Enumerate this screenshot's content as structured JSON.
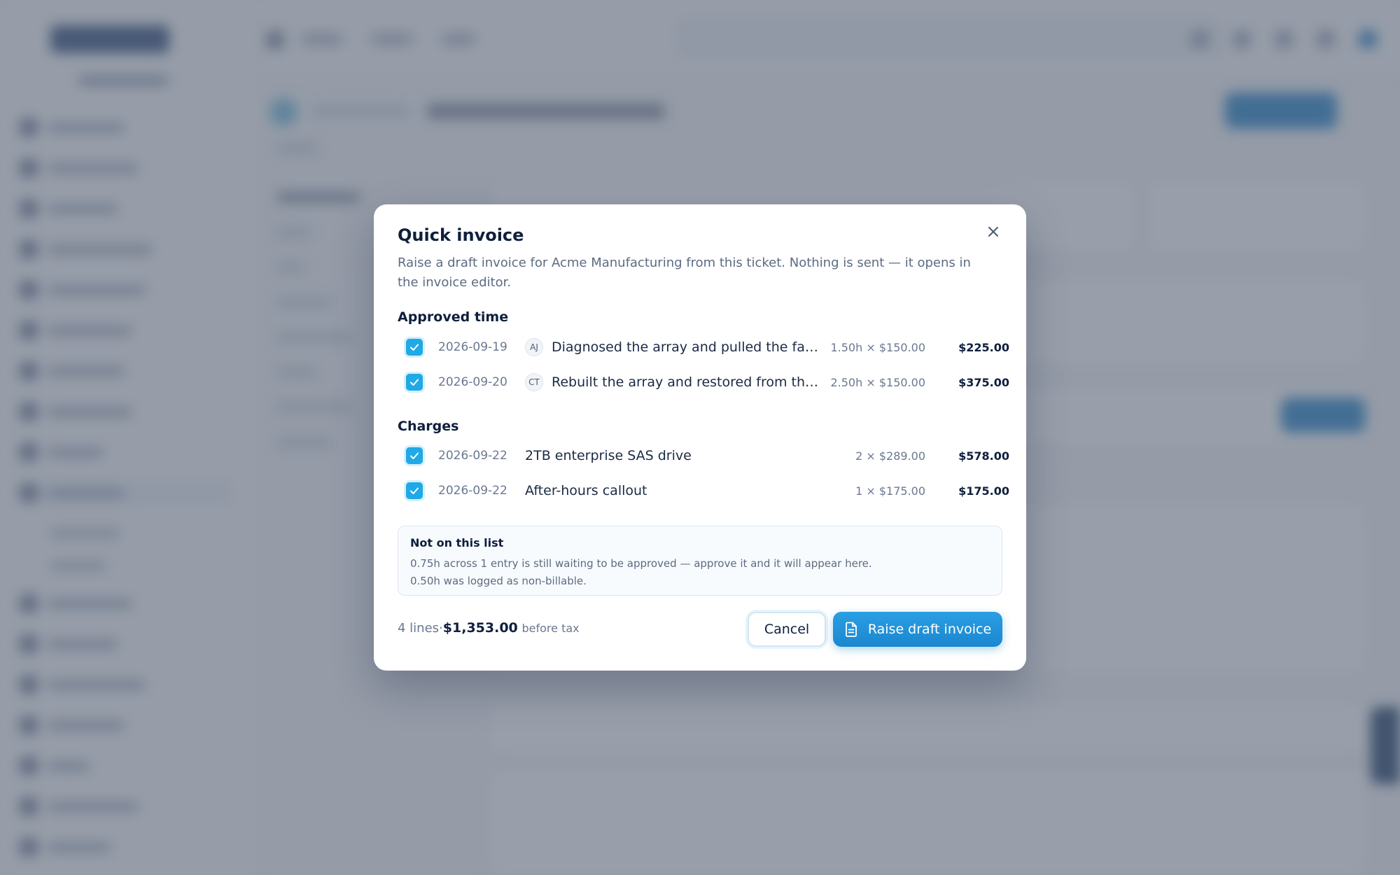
{
  "modal": {
    "title": "Quick invoice",
    "description": "Raise a draft invoice for Acme Manufacturing from this ticket. Nothing is sent — it opens in the invoice editor.",
    "close_icon": "close-icon",
    "approved_time": {
      "heading": "Approved time",
      "rows": [
        {
          "checked": true,
          "date": "2026-09-19",
          "initials": "AJ",
          "description": "Diagnosed the array and pulled the failed ...",
          "qty": "1.50h × $150.00",
          "amount": "$225.00"
        },
        {
          "checked": true,
          "date": "2026-09-20",
          "initials": "CT",
          "description": "Rebuilt the array and restored from the ov...",
          "qty": "2.50h × $150.00",
          "amount": "$375.00"
        }
      ]
    },
    "charges": {
      "heading": "Charges",
      "rows": [
        {
          "checked": true,
          "date": "2026-09-22",
          "description": "2TB enterprise SAS drive",
          "qty": "2 × $289.00",
          "amount": "$578.00"
        },
        {
          "checked": true,
          "date": "2026-09-22",
          "description": "After-hours callout",
          "qty": "1 × $175.00",
          "amount": "$175.00"
        }
      ]
    },
    "note": {
      "title": "Not on this list",
      "lines": [
        "0.75h across 1 entry is still waiting to be approved — approve it and it will appear here.",
        "0.50h was logged as non-billable."
      ]
    },
    "footer": {
      "lines_count": "4 lines",
      "separator": "·",
      "total": "$1,353.00",
      "total_suffix": "before tax",
      "cancel_label": "Cancel",
      "primary_label": "Raise draft invoice",
      "primary_icon": "document-icon"
    }
  },
  "colors": {
    "accent": "#1fa9e6",
    "primary_button": "#1b87cf",
    "overlay": "#5a6476"
  }
}
